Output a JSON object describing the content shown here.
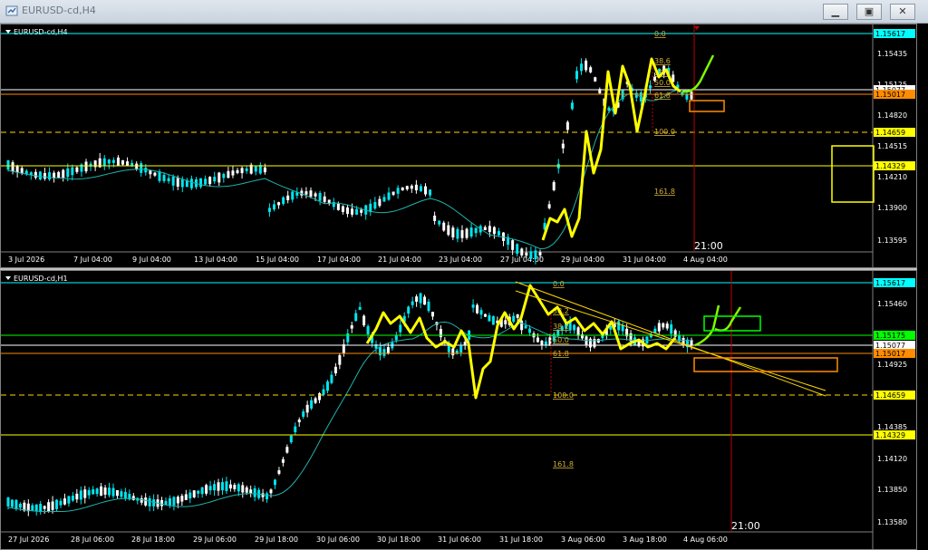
{
  "window": {
    "title": "EURUSD-cd,H4",
    "buttons": [
      "minimize",
      "maximize",
      "close"
    ]
  },
  "charts": [
    {
      "id": "h4",
      "label": "EURUSD-cd,H4",
      "price_levels": [
        {
          "value": "1.15617",
          "label": "1.15617",
          "color": "#00ffff",
          "style": "solid",
          "badge_bg": "#00ffff",
          "badge_fg": "#000000"
        },
        {
          "value": "1.15077",
          "label": "1.15077",
          "color": "#ffffff",
          "style": "solid",
          "badge_bg": "#ffffff",
          "badge_fg": "#000000"
        },
        {
          "value": "1.15017",
          "label": "1.15017",
          "color": "#ff8c00",
          "style": "solid",
          "badge_bg": "#ff8c00",
          "badge_fg": "#000000"
        },
        {
          "value": "1.14659",
          "label": "1.14659",
          "color": "#ffd700",
          "style": "dashed",
          "badge_bg": "#ffff00",
          "badge_fg": "#000000"
        },
        {
          "value": "1.14329",
          "label": "1.14329",
          "color": "#ffff00",
          "style": "solid",
          "badge_bg": "#ffff00",
          "badge_fg": "#000000"
        }
      ],
      "axis_ticks": [
        "1.15435",
        "1.15125",
        "1.14820",
        "1.14515",
        "1.14210",
        "1.13900",
        "1.13595"
      ],
      "time_ticks": [
        "3 Jul 2026",
        "7 Jul 04:00",
        "9 Jul 04:00",
        "13 Jul 04:00",
        "15 Jul 04:00",
        "17 Jul 04:00",
        "21 Jul 04:00",
        "23 Jul 04:00",
        "27 Jul 04:00",
        "29 Jul 04:00",
        "31 Jul 04:00",
        "4 Aug 04:00"
      ],
      "fib_labels": [
        "0.0",
        "38.6",
        "38.2",
        "50.0",
        "61.8",
        "100.0",
        "161.8"
      ],
      "time_marker": "21:00"
    },
    {
      "id": "h1",
      "label": "EURUSD-cd,H1",
      "price_levels": [
        {
          "value": "1.15617",
          "label": "1.15617",
          "color": "#00ffff",
          "style": "solid",
          "badge_bg": "#00ffff",
          "badge_fg": "#000000"
        },
        {
          "value": "1.15175",
          "label": "1.15175",
          "color": "#00ff00",
          "style": "solid",
          "badge_bg": "#00ff00",
          "badge_fg": "#000000"
        },
        {
          "value": "1.15077",
          "label": "1.15077",
          "color": "#ffffff",
          "style": "solid",
          "badge_bg": "#ffffff",
          "badge_fg": "#000000"
        },
        {
          "value": "1.15017",
          "label": "1.15017",
          "color": "#ff8c00",
          "style": "solid",
          "badge_bg": "#ff8c00",
          "badge_fg": "#000000"
        },
        {
          "value": "1.14659",
          "label": "1.14659",
          "color": "#ffd700",
          "style": "dashed",
          "badge_bg": "#ffff00",
          "badge_fg": "#000000"
        },
        {
          "value": "1.14329",
          "label": "1.14329",
          "color": "#ffff00",
          "style": "solid",
          "badge_bg": "#ffff00",
          "badge_fg": "#000000"
        }
      ],
      "axis_ticks": [
        "1.15460",
        "1.14925",
        "1.14385",
        "1.14120",
        "1.13850",
        "1.13580"
      ],
      "time_ticks": [
        "27 Jul 2026",
        "28 Jul 06:00",
        "28 Jul 18:00",
        "29 Jul 06:00",
        "29 Jul 18:00",
        "30 Jul 06:00",
        "30 Jul 18:00",
        "31 Jul 06:00",
        "31 Jul 18:00",
        "3 Aug 06:00",
        "3 Aug 18:00",
        "4 Aug 06:00"
      ],
      "fib_labels": [
        "0.0",
        "38.2",
        "38.2",
        "50.0",
        "61.8",
        "100.0",
        "161.8"
      ],
      "time_marker": "21:00"
    }
  ],
  "colors": {
    "bull": "#00e5ee",
    "bear": "#ffffff",
    "ma": "#20b2aa",
    "zigzag": "#ffff00",
    "projection": "#7cfc00",
    "fib": "#d4af37",
    "vline": "#c00000"
  }
}
